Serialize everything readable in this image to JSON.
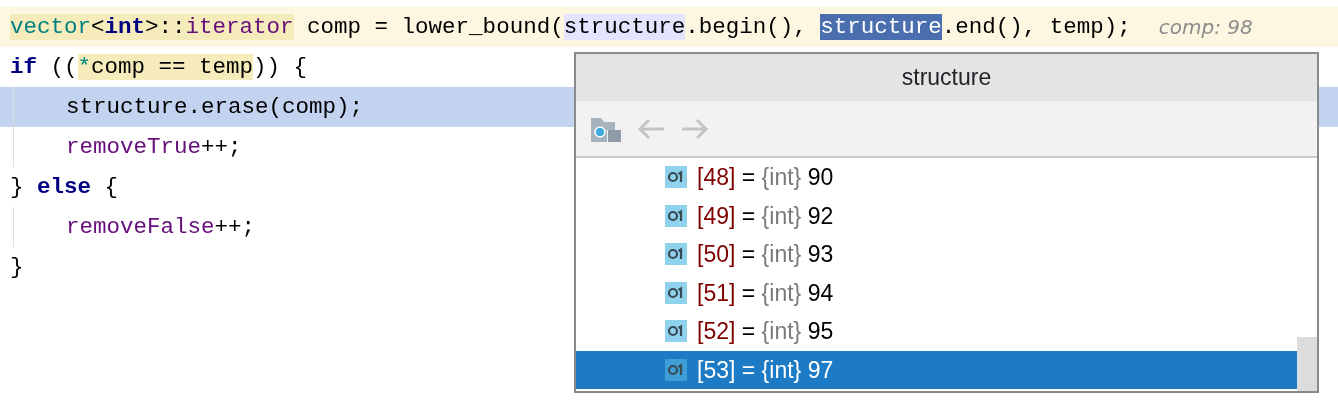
{
  "editor": {
    "lines": [
      {
        "highlighted": true,
        "selected": false,
        "indented": false,
        "tokens": [
          {
            "text": "vector",
            "kind": "type",
            "usage": true
          },
          {
            "text": "<",
            "kind": "plain",
            "usage": true
          },
          {
            "text": "int",
            "kind": "keyword",
            "usage": true
          },
          {
            "text": ">::",
            "kind": "plain",
            "usage": true
          },
          {
            "text": "iterator",
            "kind": "member",
            "usage": true
          },
          {
            "text": " comp = lower_bound(",
            "kind": "plain"
          },
          {
            "text": "structure",
            "kind": "plain",
            "read": true
          },
          {
            "text": ".begin(), ",
            "kind": "plain"
          },
          {
            "text": "structure",
            "kind": "plain",
            "selected": true
          },
          {
            "text": ".end(), temp);",
            "kind": "plain"
          }
        ],
        "hint": "comp: 98"
      },
      {
        "highlighted": false,
        "selected": false,
        "indented": false,
        "tokens": [
          {
            "text": "if",
            "kind": "keyword"
          },
          {
            "text": " ((",
            "kind": "plain"
          },
          {
            "text": "*",
            "kind": "type",
            "usage": true
          },
          {
            "text": "comp == temp",
            "kind": "plain",
            "usage": true
          },
          {
            "text": ")) {",
            "kind": "plain"
          }
        ]
      },
      {
        "highlighted": false,
        "selected": true,
        "indented": true,
        "tokens": [
          {
            "text": "structure.erase(comp);",
            "kind": "plain"
          }
        ]
      },
      {
        "highlighted": false,
        "selected": false,
        "indented": true,
        "tokens": [
          {
            "text": "removeTrue",
            "kind": "member"
          },
          {
            "text": "++;",
            "kind": "plain"
          }
        ]
      },
      {
        "highlighted": false,
        "selected": false,
        "indented": false,
        "tokens": [
          {
            "text": "} ",
            "kind": "plain"
          },
          {
            "text": "else",
            "kind": "keyword"
          },
          {
            "text": " {",
            "kind": "plain"
          }
        ]
      },
      {
        "highlighted": false,
        "selected": false,
        "indented": true,
        "tokens": [
          {
            "text": "removeFalse",
            "kind": "member"
          },
          {
            "text": "++;",
            "kind": "plain"
          }
        ]
      },
      {
        "highlighted": false,
        "selected": false,
        "indented": false,
        "tokens": [
          {
            "text": "}",
            "kind": "plain"
          }
        ]
      }
    ]
  },
  "popup": {
    "title": "structure",
    "rows": [
      {
        "index": "[48]",
        "separator": "=",
        "type": "{int}",
        "value": "90",
        "selected": false
      },
      {
        "index": "[49]",
        "separator": "=",
        "type": "{int}",
        "value": "92",
        "selected": false
      },
      {
        "index": "[50]",
        "separator": "=",
        "type": "{int}",
        "value": "93",
        "selected": false
      },
      {
        "index": "[51]",
        "separator": "=",
        "type": "{int}",
        "value": "94",
        "selected": false
      },
      {
        "index": "[52]",
        "separator": "=",
        "type": "{int}",
        "value": "95",
        "selected": false
      },
      {
        "index": "[53]",
        "separator": "=",
        "type": "{int}",
        "value": "97",
        "selected": true
      }
    ]
  }
}
